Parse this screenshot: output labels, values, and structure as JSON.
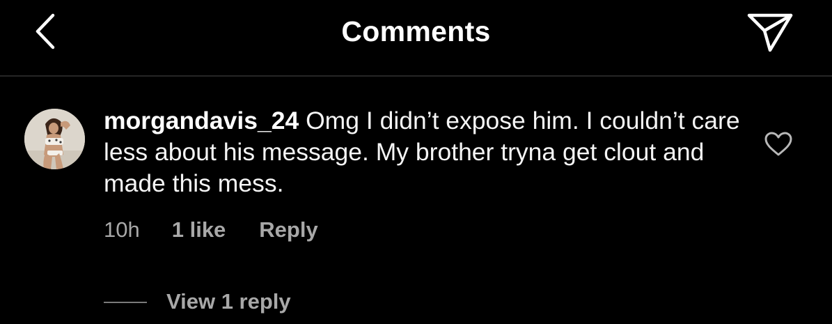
{
  "header": {
    "title": "Comments",
    "back_icon": "chevron-left-icon",
    "share_icon": "paper-plane-icon"
  },
  "comment": {
    "username": "morgandavis_24",
    "text": "Omg I didn’t expose him. I couldn’t care less about his message. My brother tryna get clout and made this mess.",
    "time": "10h",
    "likes": "1 like",
    "reply_label": "Reply",
    "like_icon": "heart-outline-icon",
    "view_replies": "View 1 reply"
  },
  "colors": {
    "background": "#000000",
    "text_primary": "#ffffff",
    "text_secondary": "#a8a8a8",
    "divider": "#262626"
  }
}
